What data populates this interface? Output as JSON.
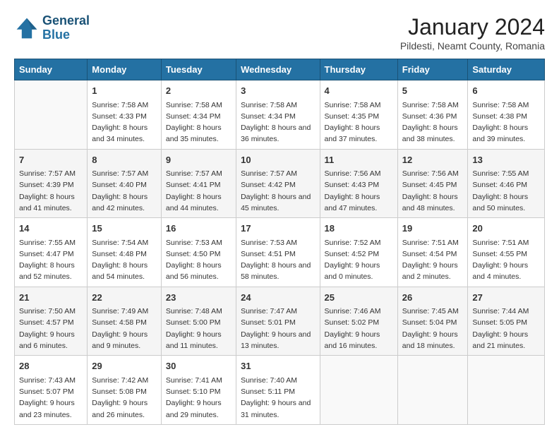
{
  "logo": {
    "line1": "General",
    "line2": "Blue"
  },
  "title": "January 2024",
  "subtitle": "Pildesti, Neamt County, Romania",
  "days_header": [
    "Sunday",
    "Monday",
    "Tuesday",
    "Wednesday",
    "Thursday",
    "Friday",
    "Saturday"
  ],
  "weeks": [
    [
      {
        "day": "",
        "info": ""
      },
      {
        "day": "1",
        "sunrise": "7:58 AM",
        "sunset": "4:33 PM",
        "daylight": "8 hours and 34 minutes."
      },
      {
        "day": "2",
        "sunrise": "7:58 AM",
        "sunset": "4:34 PM",
        "daylight": "8 hours and 35 minutes."
      },
      {
        "day": "3",
        "sunrise": "7:58 AM",
        "sunset": "4:34 PM",
        "daylight": "8 hours and 36 minutes."
      },
      {
        "day": "4",
        "sunrise": "7:58 AM",
        "sunset": "4:35 PM",
        "daylight": "8 hours and 37 minutes."
      },
      {
        "day": "5",
        "sunrise": "7:58 AM",
        "sunset": "4:36 PM",
        "daylight": "8 hours and 38 minutes."
      },
      {
        "day": "6",
        "sunrise": "7:58 AM",
        "sunset": "4:38 PM",
        "daylight": "8 hours and 39 minutes."
      }
    ],
    [
      {
        "day": "7",
        "sunrise": "7:57 AM",
        "sunset": "4:39 PM",
        "daylight": "8 hours and 41 minutes."
      },
      {
        "day": "8",
        "sunrise": "7:57 AM",
        "sunset": "4:40 PM",
        "daylight": "8 hours and 42 minutes."
      },
      {
        "day": "9",
        "sunrise": "7:57 AM",
        "sunset": "4:41 PM",
        "daylight": "8 hours and 44 minutes."
      },
      {
        "day": "10",
        "sunrise": "7:57 AM",
        "sunset": "4:42 PM",
        "daylight": "8 hours and 45 minutes."
      },
      {
        "day": "11",
        "sunrise": "7:56 AM",
        "sunset": "4:43 PM",
        "daylight": "8 hours and 47 minutes."
      },
      {
        "day": "12",
        "sunrise": "7:56 AM",
        "sunset": "4:45 PM",
        "daylight": "8 hours and 48 minutes."
      },
      {
        "day": "13",
        "sunrise": "7:55 AM",
        "sunset": "4:46 PM",
        "daylight": "8 hours and 50 minutes."
      }
    ],
    [
      {
        "day": "14",
        "sunrise": "7:55 AM",
        "sunset": "4:47 PM",
        "daylight": "8 hours and 52 minutes."
      },
      {
        "day": "15",
        "sunrise": "7:54 AM",
        "sunset": "4:48 PM",
        "daylight": "8 hours and 54 minutes."
      },
      {
        "day": "16",
        "sunrise": "7:53 AM",
        "sunset": "4:50 PM",
        "daylight": "8 hours and 56 minutes."
      },
      {
        "day": "17",
        "sunrise": "7:53 AM",
        "sunset": "4:51 PM",
        "daylight": "8 hours and 58 minutes."
      },
      {
        "day": "18",
        "sunrise": "7:52 AM",
        "sunset": "4:52 PM",
        "daylight": "9 hours and 0 minutes."
      },
      {
        "day": "19",
        "sunrise": "7:51 AM",
        "sunset": "4:54 PM",
        "daylight": "9 hours and 2 minutes."
      },
      {
        "day": "20",
        "sunrise": "7:51 AM",
        "sunset": "4:55 PM",
        "daylight": "9 hours and 4 minutes."
      }
    ],
    [
      {
        "day": "21",
        "sunrise": "7:50 AM",
        "sunset": "4:57 PM",
        "daylight": "9 hours and 6 minutes."
      },
      {
        "day": "22",
        "sunrise": "7:49 AM",
        "sunset": "4:58 PM",
        "daylight": "9 hours and 9 minutes."
      },
      {
        "day": "23",
        "sunrise": "7:48 AM",
        "sunset": "5:00 PM",
        "daylight": "9 hours and 11 minutes."
      },
      {
        "day": "24",
        "sunrise": "7:47 AM",
        "sunset": "5:01 PM",
        "daylight": "9 hours and 13 minutes."
      },
      {
        "day": "25",
        "sunrise": "7:46 AM",
        "sunset": "5:02 PM",
        "daylight": "9 hours and 16 minutes."
      },
      {
        "day": "26",
        "sunrise": "7:45 AM",
        "sunset": "5:04 PM",
        "daylight": "9 hours and 18 minutes."
      },
      {
        "day": "27",
        "sunrise": "7:44 AM",
        "sunset": "5:05 PM",
        "daylight": "9 hours and 21 minutes."
      }
    ],
    [
      {
        "day": "28",
        "sunrise": "7:43 AM",
        "sunset": "5:07 PM",
        "daylight": "9 hours and 23 minutes."
      },
      {
        "day": "29",
        "sunrise": "7:42 AM",
        "sunset": "5:08 PM",
        "daylight": "9 hours and 26 minutes."
      },
      {
        "day": "30",
        "sunrise": "7:41 AM",
        "sunset": "5:10 PM",
        "daylight": "9 hours and 29 minutes."
      },
      {
        "day": "31",
        "sunrise": "7:40 AM",
        "sunset": "5:11 PM",
        "daylight": "9 hours and 31 minutes."
      },
      {
        "day": "",
        "info": ""
      },
      {
        "day": "",
        "info": ""
      },
      {
        "day": "",
        "info": ""
      }
    ]
  ]
}
